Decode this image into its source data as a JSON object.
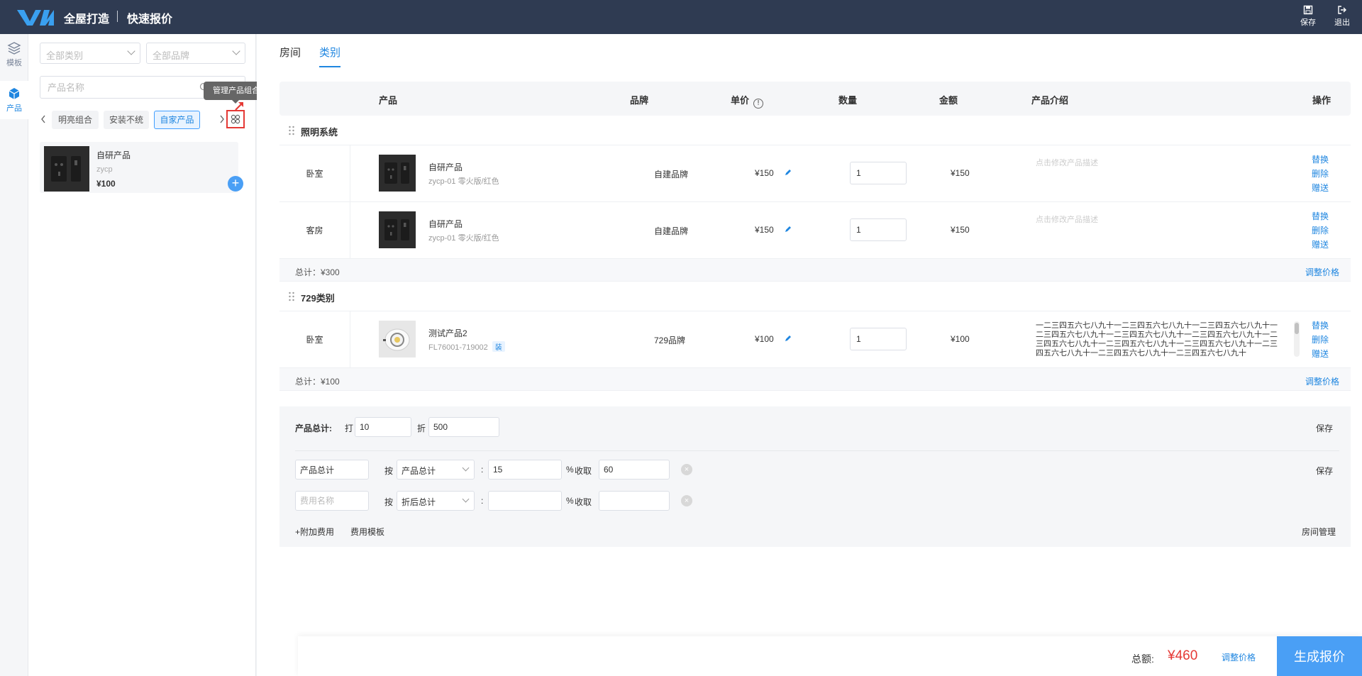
{
  "header": {
    "app_title": "全屋打造",
    "page_title": "快速报价",
    "save_label": "保存",
    "exit_label": "退出"
  },
  "rail": {
    "template_label": "模板",
    "product_label": "产品"
  },
  "panel": {
    "category_select": "全部类别",
    "brand_select": "全部品牌",
    "search_placeholder": "产品名称",
    "tooltip": "管理产品组合",
    "tags": [
      "明亮组合",
      "安装不统",
      "自家产品"
    ],
    "product": {
      "name": "自研产品",
      "code": "zycp",
      "price": "¥100"
    }
  },
  "tabs": [
    "房间",
    "类别"
  ],
  "columns": {
    "product": "产品",
    "brand": "品牌",
    "unit_price": "单价",
    "quantity": "数量",
    "amount": "金额",
    "intro": "产品介绍",
    "ops": "操作"
  },
  "ops": {
    "replace": "替换",
    "delete": "删除",
    "gift": "赠送"
  },
  "desc_placeholder": "点击修改产品描述",
  "groups": [
    {
      "name": "照明系统",
      "rows": [
        {
          "room": "卧室",
          "name": "自研产品",
          "code": "zycp-01 零火版/红色",
          "brand": "自建品牌",
          "price": "¥150",
          "qty": "1",
          "amount": "¥150"
        },
        {
          "room": "客房",
          "name": "自研产品",
          "code": "zycp-01 零火版/红色",
          "brand": "自建品牌",
          "price": "¥150",
          "qty": "1",
          "amount": "¥150"
        }
      ],
      "subtotal": "总计：¥300",
      "adjust_label": "调整价格"
    },
    {
      "name": "729类别",
      "rows": [
        {
          "room": "卧室",
          "name": "测试产品2",
          "code": "FL76001-719002",
          "badge": "装",
          "brand": "729品牌",
          "price": "¥100",
          "qty": "1",
          "amount": "¥100",
          "desc": "一二三四五六七八九十一二三四五六七八九十一二三四五六七八九十一二三四五六七八九十一二三四五六七八九十一二三四五六七八九十一二三四五六七八九十一二三四五六七八九十一二三四五六七八九十一二三四五六七八九十一二三四五六七八九十一二三四五六七八九十"
        }
      ],
      "subtotal": "总计：¥100",
      "adjust_label": "调整价格"
    }
  ],
  "totals": {
    "label": "产品总计:",
    "discount_prefix": "打",
    "discount_value": "10",
    "discount_suffix": "折",
    "discount_total": "500",
    "save_label": "保存",
    "fee_rows": [
      {
        "name": "产品总计",
        "by_label": "按",
        "basis": "产品总计",
        "colon": ":",
        "percent": "15",
        "percent_label": "%",
        "collect_label": "收取",
        "collect": "60"
      },
      {
        "name": "",
        "name_placeholder": "费用名称",
        "by_label": "按",
        "basis": "折后总计",
        "colon": ":",
        "percent": "",
        "percent_label": "%",
        "collect_label": "收取",
        "collect": ""
      }
    ],
    "add_fee": "+附加费用",
    "fee_template": "费用模板",
    "room_manage": "房间管理"
  },
  "footer": {
    "total_label": "总额:",
    "total_value": "¥460",
    "adjust_label": "调整价格",
    "generate_label": "生成报价"
  },
  "colors": {
    "header": "#2f3b52",
    "accent": "#1f86e0",
    "price_red": "#e53935"
  }
}
